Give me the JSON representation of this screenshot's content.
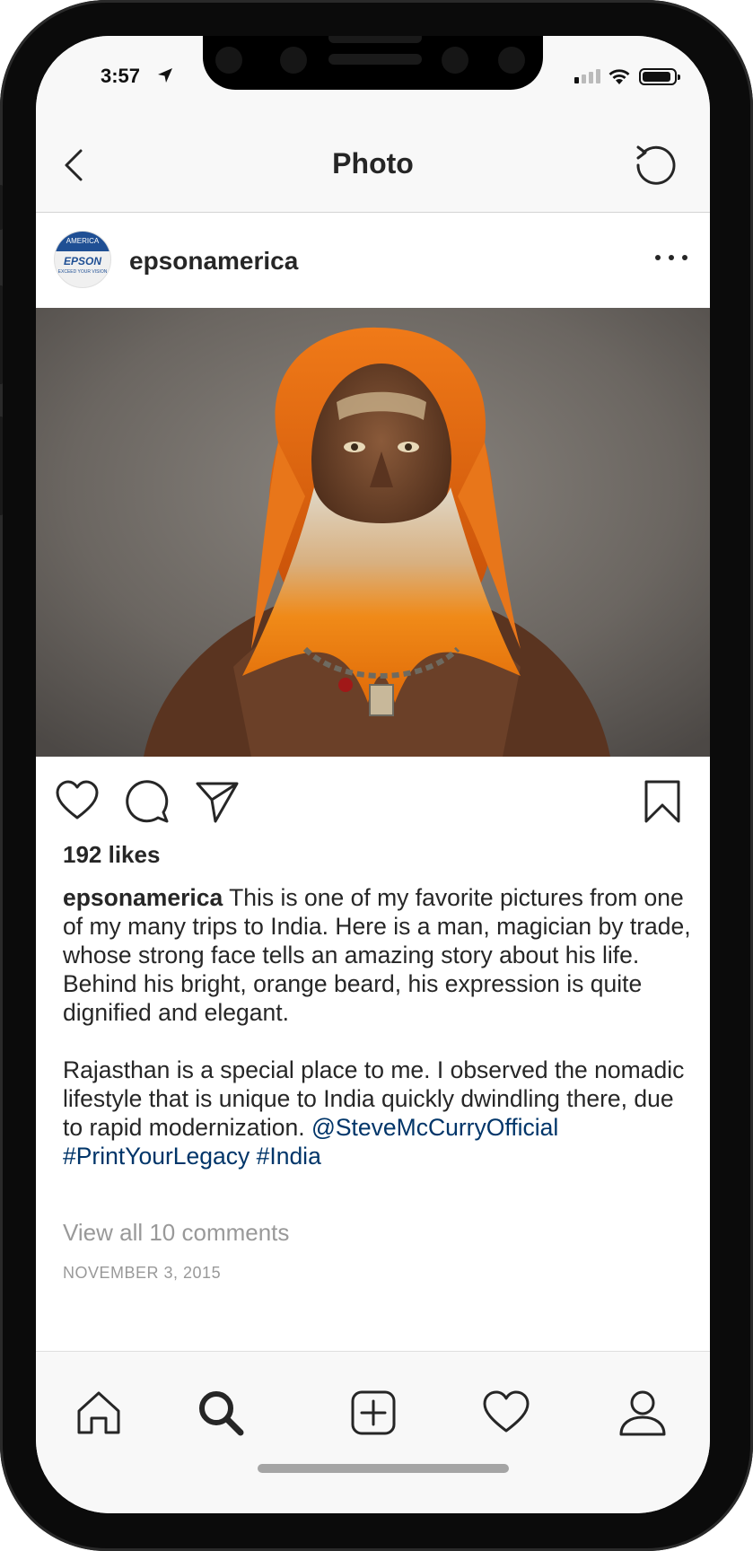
{
  "status_bar": {
    "time": "3:57",
    "signal_bars_active": 1,
    "signal_bars_total": 4,
    "battery_level": 0.9,
    "icons": [
      "location-arrow-icon",
      "cellular-signal-icon",
      "wifi-icon",
      "battery-icon"
    ]
  },
  "header": {
    "title": "Photo",
    "back_icon": "chevron-left-icon",
    "refresh_icon": "refresh-icon"
  },
  "post": {
    "avatar": {
      "band_text": "AMERICA",
      "logo_text": "EPSON",
      "tagline": "EXCEED YOUR VISION"
    },
    "username": "epsonamerica",
    "more_icon": "ellipsis-icon",
    "image": "portrait photo of an elderly man with bright orange hair and beard",
    "likes": "192 likes",
    "caption": {
      "author": "epsonamerica",
      "text_1": " This is one of my favorite pictures from one of my many trips to India. Here is a man, magician by trade, whose strong face tells an amazing story about his life. Behind his bright, orange beard, his expression is quite dignified and elegant.",
      "text_2": "Rajasthan is a special place to me. I observed the nomadic lifestyle that is unique to India quickly dwindling there, due to rapid modernization.",
      "mention": "@SteveMcCurryOfficial",
      "hashtag_1": "#PrintYourLegacy",
      "hashtag_2": "#India"
    },
    "view_comments": "View all 10 comments",
    "date": "NOVEMBER 3, 2015"
  },
  "actions": [
    "heart-icon",
    "comment-icon",
    "share-icon",
    "bookmark-icon"
  ],
  "tabbar": [
    "home-icon",
    "search-icon",
    "add-post-icon",
    "activity-heart-icon",
    "profile-icon"
  ],
  "colors": {
    "text": "#262626",
    "link": "#003569",
    "muted": "#999999",
    "bar_bg": "#f8f8f8"
  }
}
